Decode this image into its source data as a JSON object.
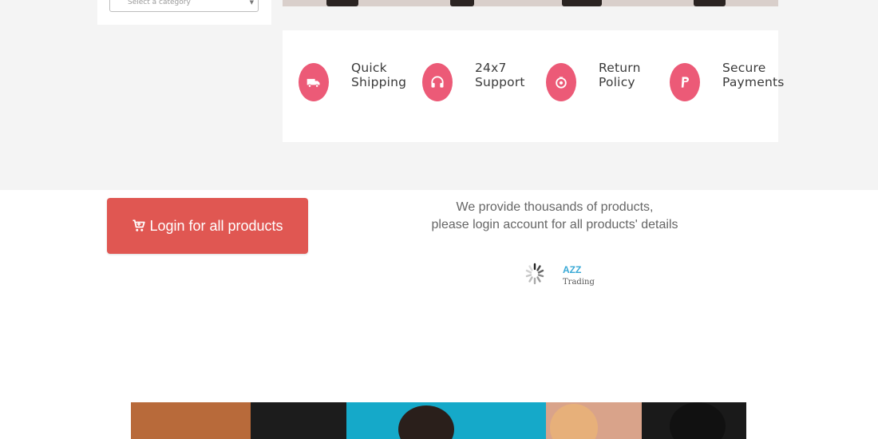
{
  "category": {
    "placeholder": "Select a category"
  },
  "features": [
    {
      "label": "Quick\nShipping",
      "icon": "truck-icon"
    },
    {
      "label": "24x7\nSupport",
      "icon": "headphones-icon"
    },
    {
      "label": "Return\nPolicy",
      "icon": "return-icon"
    },
    {
      "label": "Secure\nPayments",
      "icon": "payment-icon"
    }
  ],
  "login": {
    "label": "Login for all products",
    "icon": "cart-icon"
  },
  "message": {
    "line1": "We provide thousands of products,",
    "line2": "please login account for all products' details"
  },
  "brand": {
    "name": "AZZ",
    "subtitle": "Trading"
  },
  "colors": {
    "accent": "#ec5a77",
    "button": "#e05752",
    "brand": "#39a9d6"
  }
}
